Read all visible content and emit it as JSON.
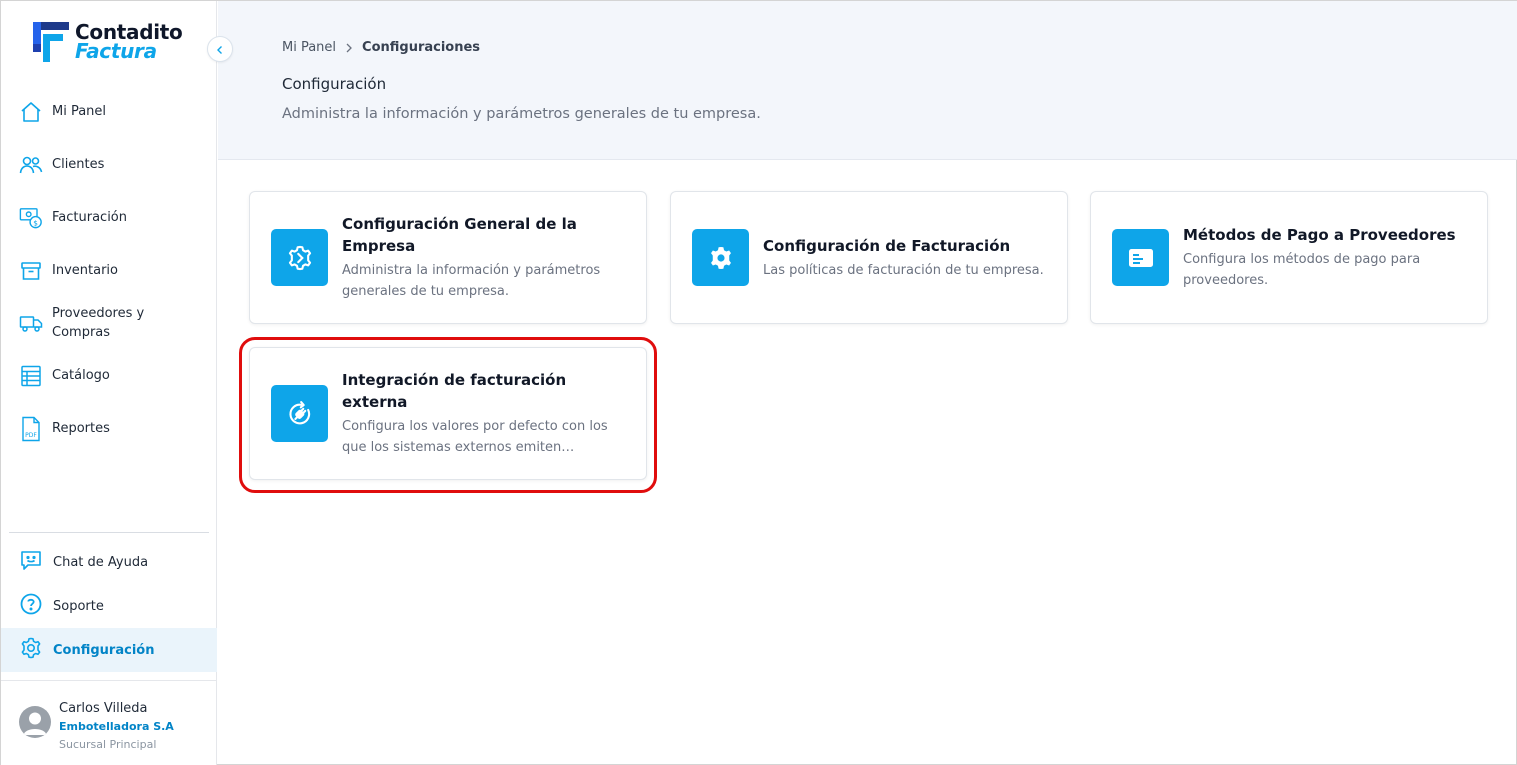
{
  "brand": {
    "line1": "Contadito",
    "line2": "Factura",
    "accent": "#0ea5e9",
    "dark": "#0f172a"
  },
  "sidebar": {
    "items": [
      {
        "label": "Mi Panel",
        "icon": "home-icon"
      },
      {
        "label": "Clientes",
        "icon": "users-icon"
      },
      {
        "label": "Facturación",
        "icon": "invoice-money-icon"
      },
      {
        "label": "Inventario",
        "icon": "archive-box-icon"
      },
      {
        "label": "Proveedores y Compras",
        "icon": "truck-icon"
      },
      {
        "label": "Catálogo",
        "icon": "catalog-list-icon"
      },
      {
        "label": "Reportes",
        "icon": "pdf-file-icon"
      }
    ],
    "bottom": [
      {
        "label": "Chat de Ayuda",
        "icon": "chat-bot-icon"
      },
      {
        "label": "Soporte",
        "icon": "question-circle-icon"
      },
      {
        "label": "Configuración",
        "icon": "gear-icon",
        "active": true
      }
    ]
  },
  "user": {
    "name": "Carlos Villeda",
    "company": "Embotelladora S.A",
    "branch": "Sucursal Principal"
  },
  "header": {
    "breadcrumb_home": "Mi Panel",
    "breadcrumb_current": "Configuraciones",
    "title": "Configuración",
    "subtitle": "Administra la información y parámetros generales de tu empresa."
  },
  "cards": [
    {
      "title": "Configuración General de la Empresa",
      "description": "Administra la información y parámetros generales de tu empresa.",
      "icon": "gear-arrows-icon"
    },
    {
      "title": "Configuración de Facturación",
      "description": "Las políticas de facturación de tu empresa.",
      "icon": "gear-icon"
    },
    {
      "title": "Métodos de Pago a Proveedores",
      "description": "Configura los métodos de pago para proveedores.",
      "icon": "payment-card-icon"
    },
    {
      "title": "Integración de facturación externa",
      "description": "Configura los valores por defecto con los que los sistemas externos emiten…",
      "icon": "plug-sync-icon",
      "highlighted": true
    }
  ],
  "colors": {
    "highlight": "#e00d0d",
    "active_text": "#0284c7",
    "active_bg": "#eaf4fb",
    "header_bg": "#f3f6fb"
  }
}
